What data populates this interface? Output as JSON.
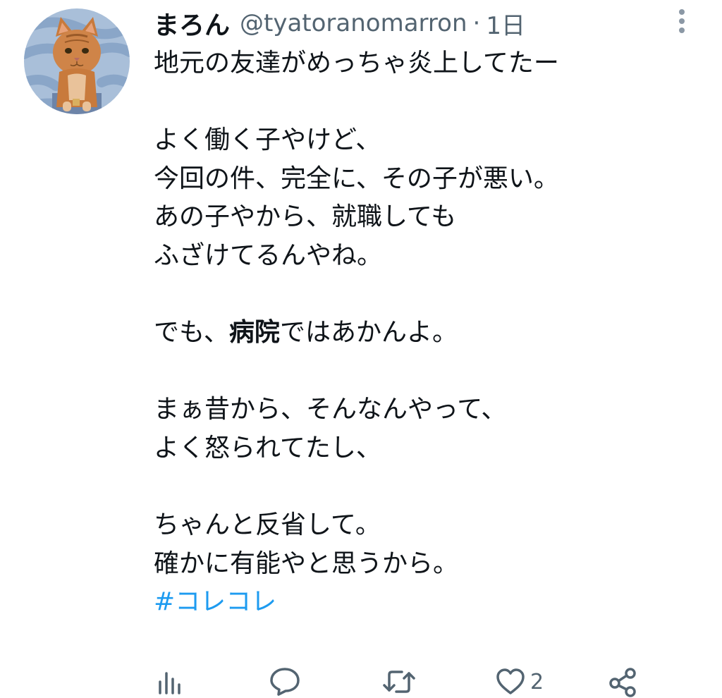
{
  "tweet": {
    "author": {
      "display_name": "まろん",
      "handle": "@tyatoranomarron",
      "separator": "·",
      "timestamp": "1日"
    },
    "body": {
      "l1": "地元の友達がめっちゃ炎上してたー",
      "l2": "よく働く子やけど、",
      "l3": "今回の件、完全に、その子が悪い。",
      "l4": "あの子やから、就職しても",
      "l5": "ふざけてるんやね。",
      "l6_pre": "でも、",
      "l6_bold": "病院",
      "l6_post": "ではあかんよ。",
      "l7": "まぁ昔から、そんなんやって、",
      "l8": "よく怒られてたし、",
      "l9": "ちゃんと反省して。",
      "l10": "確かに有能やと思うから。",
      "hashtag": "#コレコレ"
    },
    "actions": {
      "like_count": "2"
    }
  },
  "icons": [
    "more-vertical-icon",
    "analytics-icon",
    "reply-icon",
    "retweet-icon",
    "heart-icon",
    "share-icon"
  ],
  "colors": {
    "hashtag": "#1d9bf0",
    "secondary_text": "#536471",
    "primary_text": "#0f1419"
  }
}
